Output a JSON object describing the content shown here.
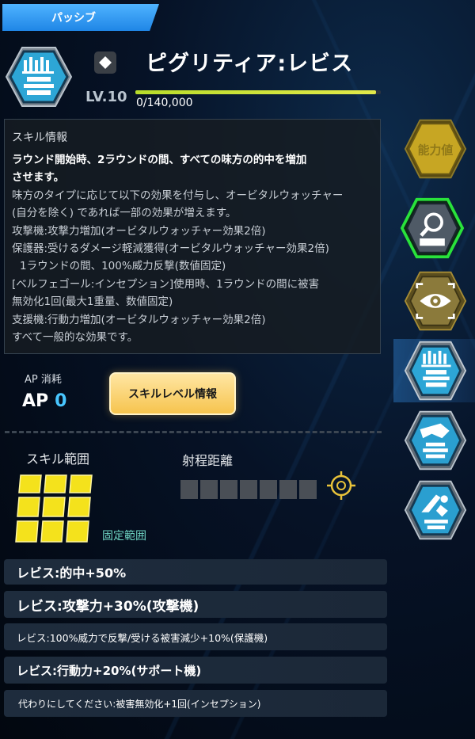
{
  "header": {
    "tab_label": "パッシブ",
    "skill_name": "ピグリティア:レビス",
    "level": "LV.10",
    "xp_text": "0/140,000",
    "xp_progress": 0.98
  },
  "skill_info": {
    "title": "スキル情報",
    "lines": [
      "ラウンド開始時、2ラウンドの間、すべての味方の的中を増加",
      "させます。",
      "味方のタイプに応じて以下の効果を付与し、オービタルウォッチャー",
      "(自分を除く) であれば一部の効果が増えます。",
      "攻撃機:攻撃力増加(オービタルウォッチャー効果2倍)",
      "保護器:受けるダメージ軽減獲得(オービタルウォッチャー効果2倍)",
      "1ラウンドの間、100%威力反撃(数値固定)",
      "[ベルフェゴール:インセプション]使用時、1ラウンドの間に被害",
      "無効化1回(最大1重量、数値固定)",
      "支援機:行動力増加(オービタルウォッチャー効果2倍)",
      "すべて一般的な効果です。"
    ]
  },
  "ap": {
    "label": "AP 消耗",
    "prefix": "AP",
    "value": "0"
  },
  "buttons": {
    "skill_level_info": "スキルレベル情報"
  },
  "range": {
    "title": "スキル範囲",
    "fixed_label": "固定範囲",
    "distance_title": "射程距離"
  },
  "effects": [
    "レビス:的中+50%",
    "レビス:攻撃力+30%(攻撃機)",
    "レビス:100%威力で反撃/受ける被害減少+10%(保護機)",
    "レビス:行動力+20%(サポート機)",
    "代わりにしてください:被害無効化+1回(インセプション)"
  ],
  "sidebar": {
    "stats_label": "能力値"
  },
  "colors": {
    "accent_blue": "#48c6ff",
    "tab_blue": "#1f86e6",
    "button_gold": "#f6c44e",
    "range_yellow": "#f4e21c",
    "fixed_teal": "#6fd5c4",
    "xp_green": "#b8dc2a"
  }
}
